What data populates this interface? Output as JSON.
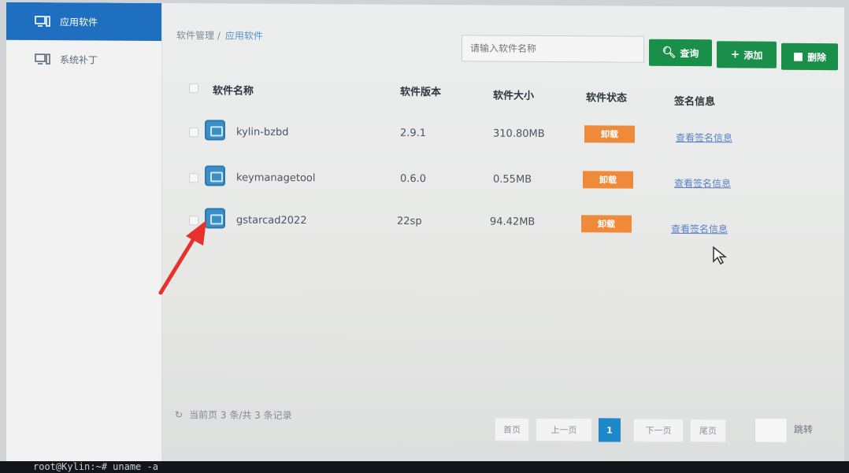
{
  "sidebar": {
    "items": [
      {
        "label": "应用软件",
        "icon": "monitor-icon",
        "active": true
      },
      {
        "label": "系统补丁",
        "icon": "monitor-icon",
        "active": false
      }
    ]
  },
  "breadcrumb": {
    "parent": "软件管理 /",
    "current": "应用软件"
  },
  "search": {
    "placeholder": "请输入软件名称"
  },
  "toolbar": {
    "query_label": "查询",
    "add_label": "添加",
    "delete_label": "删除"
  },
  "table": {
    "columns": [
      "软件名称",
      "软件版本",
      "软件大小",
      "软件状态",
      "签名信息"
    ],
    "rows": [
      {
        "name": "kylin-bzbd",
        "version": "2.9.1",
        "size": "310.80MB",
        "status": "卸载",
        "sign": "查看签名信息"
      },
      {
        "name": "keymanagetool",
        "version": "0.6.0",
        "size": "0.55MB",
        "status": "卸载",
        "sign": "查看签名信息"
      },
      {
        "name": "gstarcad2022",
        "version": "22sp",
        "size": "94.42MB",
        "status": "卸载",
        "sign": "查看签名信息"
      }
    ]
  },
  "footer": {
    "summary": "当前页 3 条/共 3 条记录"
  },
  "pagination": {
    "first": "首页",
    "prev": "上一页",
    "current": "1",
    "next": "下一页",
    "last": "尾页",
    "jump": "跳转"
  },
  "terminal": {
    "text": "root@Kylin:~# uname -a"
  },
  "colors": {
    "accent": "#1e6fbf",
    "button": "#1a8f4a",
    "status": "#ef8a3a",
    "link": "#5a82c4",
    "annotation_arrow": "#e8312c"
  }
}
